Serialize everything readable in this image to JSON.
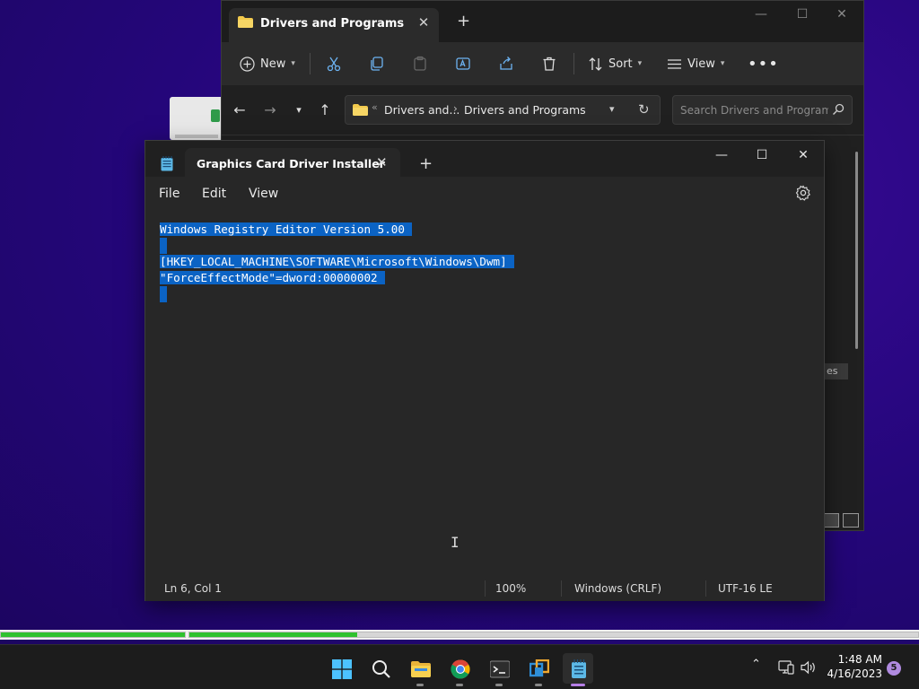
{
  "explorer": {
    "tab_title": "Drivers and Programs",
    "toolbar": {
      "new_label": "New",
      "sort_label": "Sort",
      "view_label": "View"
    },
    "address": {
      "crumb_short": "Drivers and...",
      "crumb_current": "Drivers and Programs"
    },
    "search_placeholder": "Search Drivers and Programs",
    "body_fragment": "es"
  },
  "notepad": {
    "tab_title": "Graphics Card Driver Installer",
    "menu": [
      "File",
      "Edit",
      "View"
    ],
    "lines": [
      "Windows Registry Editor Version 5.00",
      "",
      "[HKEY_LOCAL_MACHINE\\SOFTWARE\\Microsoft\\Windows\\Dwm]",
      "\"ForceEffectMode\"=dword:00000002",
      ""
    ],
    "status": {
      "position": "Ln 6, Col 1",
      "zoom": "100%",
      "line_ending": "Windows (CRLF)",
      "encoding": "UTF-16 LE"
    }
  },
  "progress": {
    "bar1_fraction": 1.0,
    "bar2_fraction": 0.23
  },
  "taskbar": {
    "apps": [
      "start-icon",
      "search-icon",
      "file-explorer-icon",
      "chrome-icon",
      "terminal-icon",
      "virtualbox-icon",
      "notepad-icon"
    ],
    "time": "1:48 AM",
    "date": "4/16/2023",
    "notification_count": "5"
  },
  "colors": {
    "selection": "#0b63c4",
    "desktop": "#24067a",
    "progress_fill": "#2ec22e",
    "accent": "#b67fe6"
  }
}
